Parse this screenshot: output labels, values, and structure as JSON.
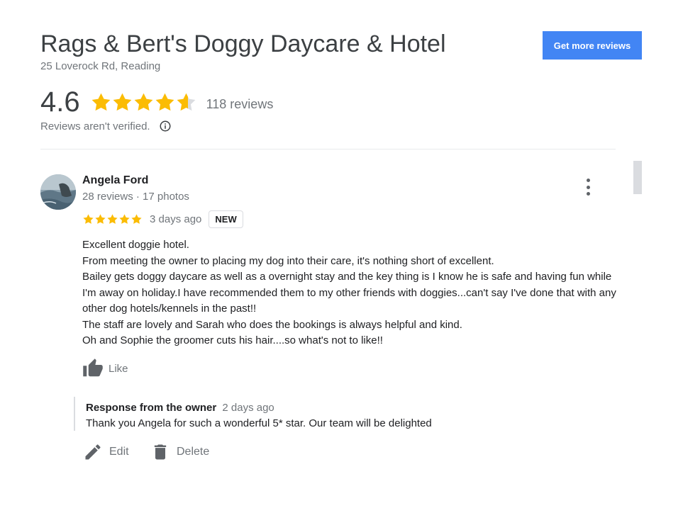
{
  "business": {
    "name": "Rags & Bert's Doggy Daycare & Hotel",
    "address": "25 Loverock Rd, Reading",
    "cta_label": "Get more reviews",
    "rating": "4.6",
    "rating_value": 4.6,
    "review_count": "118 reviews",
    "verify_note": "Reviews aren't verified.",
    "star_color": "#fbbc04",
    "accent_color": "#4285f4"
  },
  "review": {
    "author": "Angela Ford",
    "meta": "28 reviews · 17 photos",
    "stars": 5,
    "time": "3 days ago",
    "badge": "NEW",
    "lines": [
      "Excellent doggie hotel.",
      "From meeting the owner to placing my dog into their care, it's nothing short of excellent.",
      "Bailey gets doggy daycare as well as a overnight stay and the key thing is I know he is safe and having fun while I'm away on holiday.I have recommended them to my other friends with doggies...can't say I've done that with any other dog hotels/kennels in the past!!",
      "The staff are lovely and Sarah who does the bookings is always helpful and kind.",
      "Oh and Sophie the groomer cuts his hair....so what's not to like!!"
    ],
    "like_label": "Like"
  },
  "owner_response": {
    "heading": "Response from the owner",
    "time": "2 days ago",
    "text": "Thank you Angela for such a wonderful 5* star. Our team will be delighted"
  },
  "actions": {
    "edit_label": "Edit",
    "delete_label": "Delete"
  },
  "icons": {
    "info": "info-icon",
    "more": "more-vert-icon",
    "like": "thumb-up-icon",
    "edit": "pencil-icon",
    "delete": "trash-icon"
  }
}
